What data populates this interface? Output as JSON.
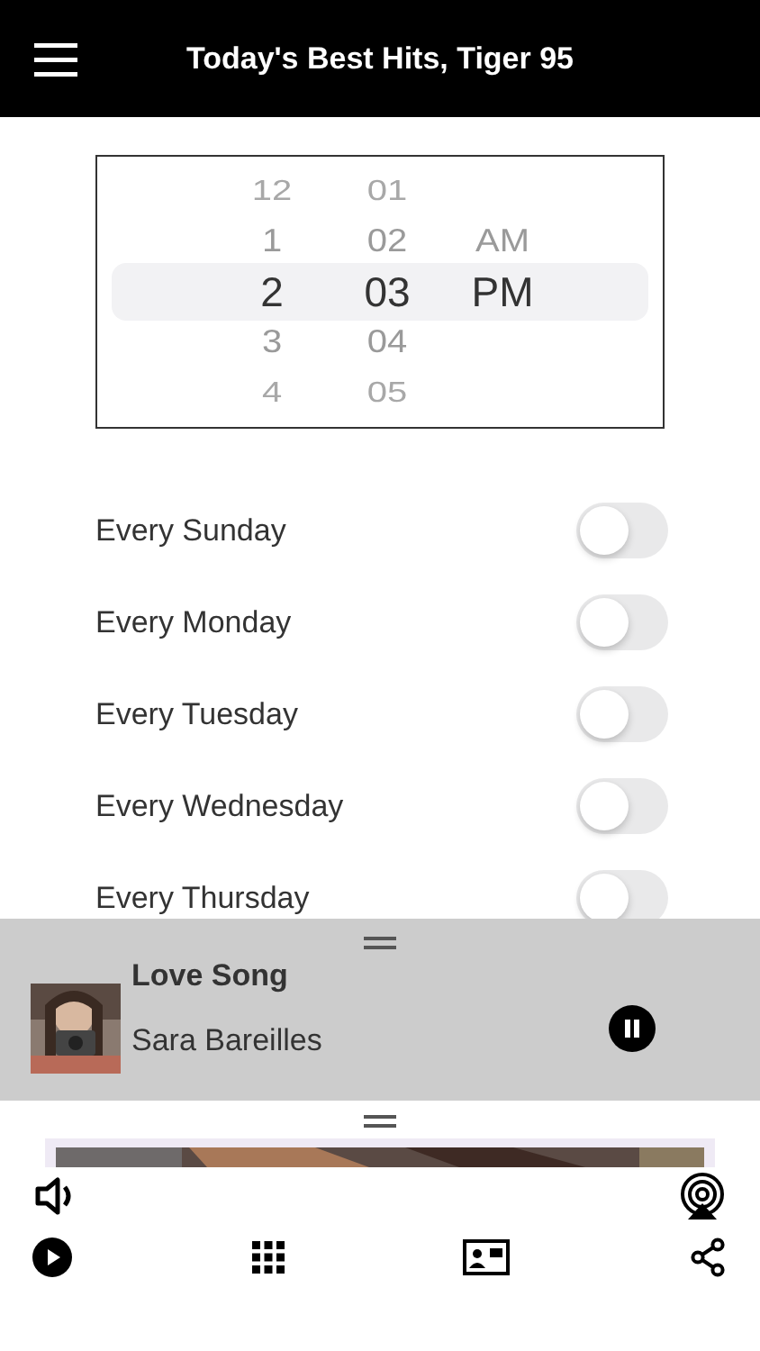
{
  "header": {
    "title": "Today's Best Hits, Tiger 95"
  },
  "time_picker": {
    "columns": [
      {
        "items": [
          {
            "label": "12",
            "selected": false
          },
          {
            "label": "1",
            "selected": false
          },
          {
            "label": "2",
            "selected": true
          },
          {
            "label": "3",
            "selected": false
          },
          {
            "label": "4",
            "selected": false
          }
        ]
      },
      {
        "items": [
          {
            "label": "01",
            "selected": false
          },
          {
            "label": "02",
            "selected": false
          },
          {
            "label": "03",
            "selected": true
          },
          {
            "label": "04",
            "selected": false
          },
          {
            "label": "05",
            "selected": false
          }
        ]
      },
      {
        "items": [
          {
            "label": "AM",
            "selected": false
          },
          {
            "label": "PM",
            "selected": true
          }
        ]
      }
    ]
  },
  "days": [
    {
      "label": "Every Sunday",
      "on": false
    },
    {
      "label": "Every Monday",
      "on": false
    },
    {
      "label": "Every Tuesday",
      "on": false
    },
    {
      "label": "Every Wednesday",
      "on": false
    },
    {
      "label": "Every Thursday",
      "on": false
    }
  ],
  "now_playing": {
    "title": "Love Song",
    "artist": "Sara Bareilles",
    "playing": true
  }
}
